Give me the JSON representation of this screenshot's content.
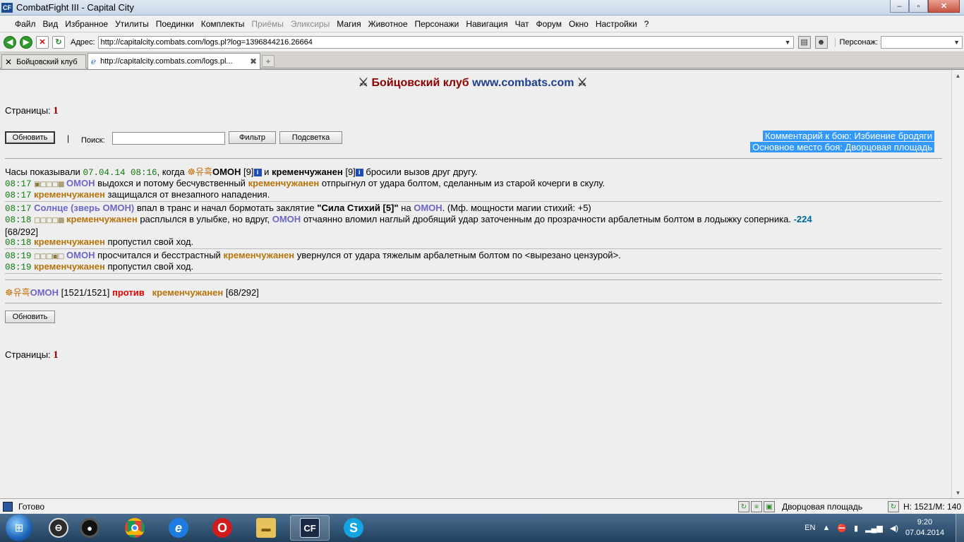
{
  "window": {
    "title": "CombatFight III - Capital City",
    "logo": "CF",
    "controls": {
      "minimize": "–",
      "maximize": "▫",
      "close": "✕"
    }
  },
  "menu": [
    "Файл",
    "Вид",
    "Избранное",
    "Утилиты",
    "Поединки",
    "Комплекты",
    "Приёмы",
    "Эликсиры",
    "Магия",
    "Животное",
    "Персонажи",
    "Навигация",
    "Чат",
    "Форум",
    "Окно",
    "Настройки",
    "?"
  ],
  "menu_disabled": [
    "Приёмы",
    "Эликсиры"
  ],
  "address": {
    "label": "Адрес:",
    "url": "http://capitalcity.combats.com/logs.pl?log=1396844216.26664",
    "persona_label": "Персонаж:",
    "persona_value": ""
  },
  "tabs": [
    {
      "label": "Бойцовский клуб",
      "icon": "swords-icon",
      "active": false
    },
    {
      "label": "http://capitalcity.combats.com/logs.pl...",
      "icon": "ie-icon",
      "active": true
    }
  ],
  "page": {
    "header_club": "Бойцовский клуб",
    "header_site": "www.combats.com",
    "pages_label": "Страницы:",
    "pages_value": "1",
    "refresh_label": "Обновить",
    "pipe": "|",
    "search_label": "Поиск:",
    "search_value": "",
    "filter_label": "Фильтр",
    "highlight_label": "Подсветка",
    "comment_line1": "Комментарий к бою: Избиение бродяги",
    "comment_line2": "Основное место боя: Дворцовая площадь"
  },
  "log": {
    "intro_prefix": "Часы показывали",
    "intro_date": "07.04.14 08:16",
    "intro_when": ", когда",
    "fighter1": "ОМОН",
    "fighter1_level": "[9]",
    "intro_and": "и",
    "fighter2": "кременчужанен",
    "fighter2_level": "[9]",
    "intro_suffix": "бросили вызов друг другу.",
    "entries": {
      "e1_time": "08:17",
      "e1_squares": "▣□□□▩",
      "e1_text_a": "выдохся и потому бесчувственный",
      "e1_text_b": "отпрыгнул от удара болтом, сделанным из старой кочерги в скулу.",
      "e2_time": "08:17",
      "e2_text": "защищался от внезапного нападения.",
      "e3_time": "08:17",
      "e3_actor": "Солнце (зверь ОМОН)",
      "e3_text_a": "впал в транс и начал бормотать заклятие",
      "e3_spell": "\"Сила Стихий [5]\"",
      "e3_on": "на",
      "e3_text_b": ". (Мф. мощности магии стихий: +5)",
      "e4_time": "08:18",
      "e4_squares": "□□□□▩",
      "e4_text_a": "расплылся в улыбке, но вдруг,",
      "e4_text_b": "отчаянно вломил наглый дробящий удар заточенным до прозрачности арбалетным болтом в лодыжку соперника.",
      "e4_damage": "-224",
      "e4_hp": "[68/292]",
      "e5_time": "08:18",
      "e5_text": "пропустил свой ход.",
      "e6_time": "08:19",
      "e6_squares": "□□□▣□",
      "e6_text_a": "просчитался и бесстрастный",
      "e6_text_b": "увернулся от удара тяжелым арбалетным болтом по <вырезано цензурой>.",
      "e7_time": "08:19",
      "e7_text": "пропустил свой ход."
    },
    "summary_f1_hp": "[1521/1521]",
    "summary_vs": "против",
    "summary_f2_hp": "[68/292]"
  },
  "status": {
    "left_text": "Готово",
    "location": "Дворцовая площадь",
    "hm": "H: 1521/M: 140"
  },
  "taskbar": {
    "lang": "EN",
    "time": "9:20",
    "date": "07.04.2014",
    "apps": [
      "steam-icon",
      "camera-icon",
      "chrome-icon",
      "ie-icon",
      "opera-icon",
      "folder-icon",
      "cf-icon",
      "skype-icon"
    ]
  }
}
